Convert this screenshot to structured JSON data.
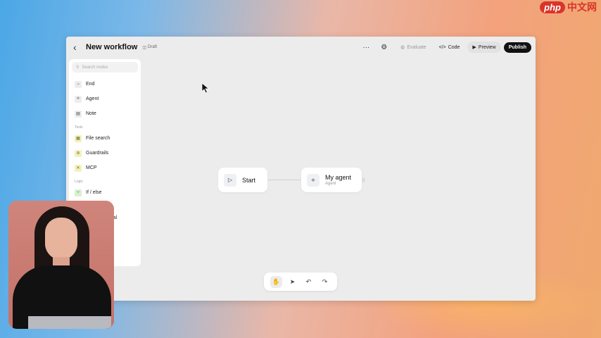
{
  "watermark": {
    "logo": "php",
    "text": "中文网"
  },
  "header": {
    "back_icon": "chevron-left-icon",
    "title": "New workflow",
    "badge": "Draft",
    "more_icon": "ellipsis-icon",
    "settings_icon": "gear-icon",
    "evaluate_label": "Evaluate",
    "code_label": "Code",
    "preview_label": "Preview",
    "publish_label": "Publish"
  },
  "sidebar": {
    "search_placeholder": "Search nodes",
    "core_items": [
      {
        "label": "End",
        "icon": "end-circle-icon"
      },
      {
        "label": "Agent",
        "icon": "agent-icon"
      },
      {
        "label": "Note",
        "icon": "note-icon"
      }
    ],
    "tools_label": "Tools",
    "tool_items": [
      {
        "label": "File search",
        "icon": "file-search-icon"
      },
      {
        "label": "Guardrails",
        "icon": "guardrails-icon"
      },
      {
        "label": "MCP",
        "icon": "mcp-icon"
      }
    ],
    "logic_label": "Logic",
    "logic_items": [
      {
        "label": "If / else",
        "icon": "branch-icon"
      }
    ],
    "partial_item": "roval"
  },
  "canvas": {
    "start_node": {
      "label": "Start",
      "icon": "play-icon"
    },
    "agent_node": {
      "label": "My agent",
      "sublabel": "Agent",
      "icon": "agent-icon"
    }
  },
  "toolbar": {
    "tools": [
      "hand-icon",
      "pointer-icon",
      "undo-icon",
      "redo-icon"
    ]
  },
  "colors": {
    "publish_bg": "#111111",
    "canvas_bg": "#ececec"
  }
}
